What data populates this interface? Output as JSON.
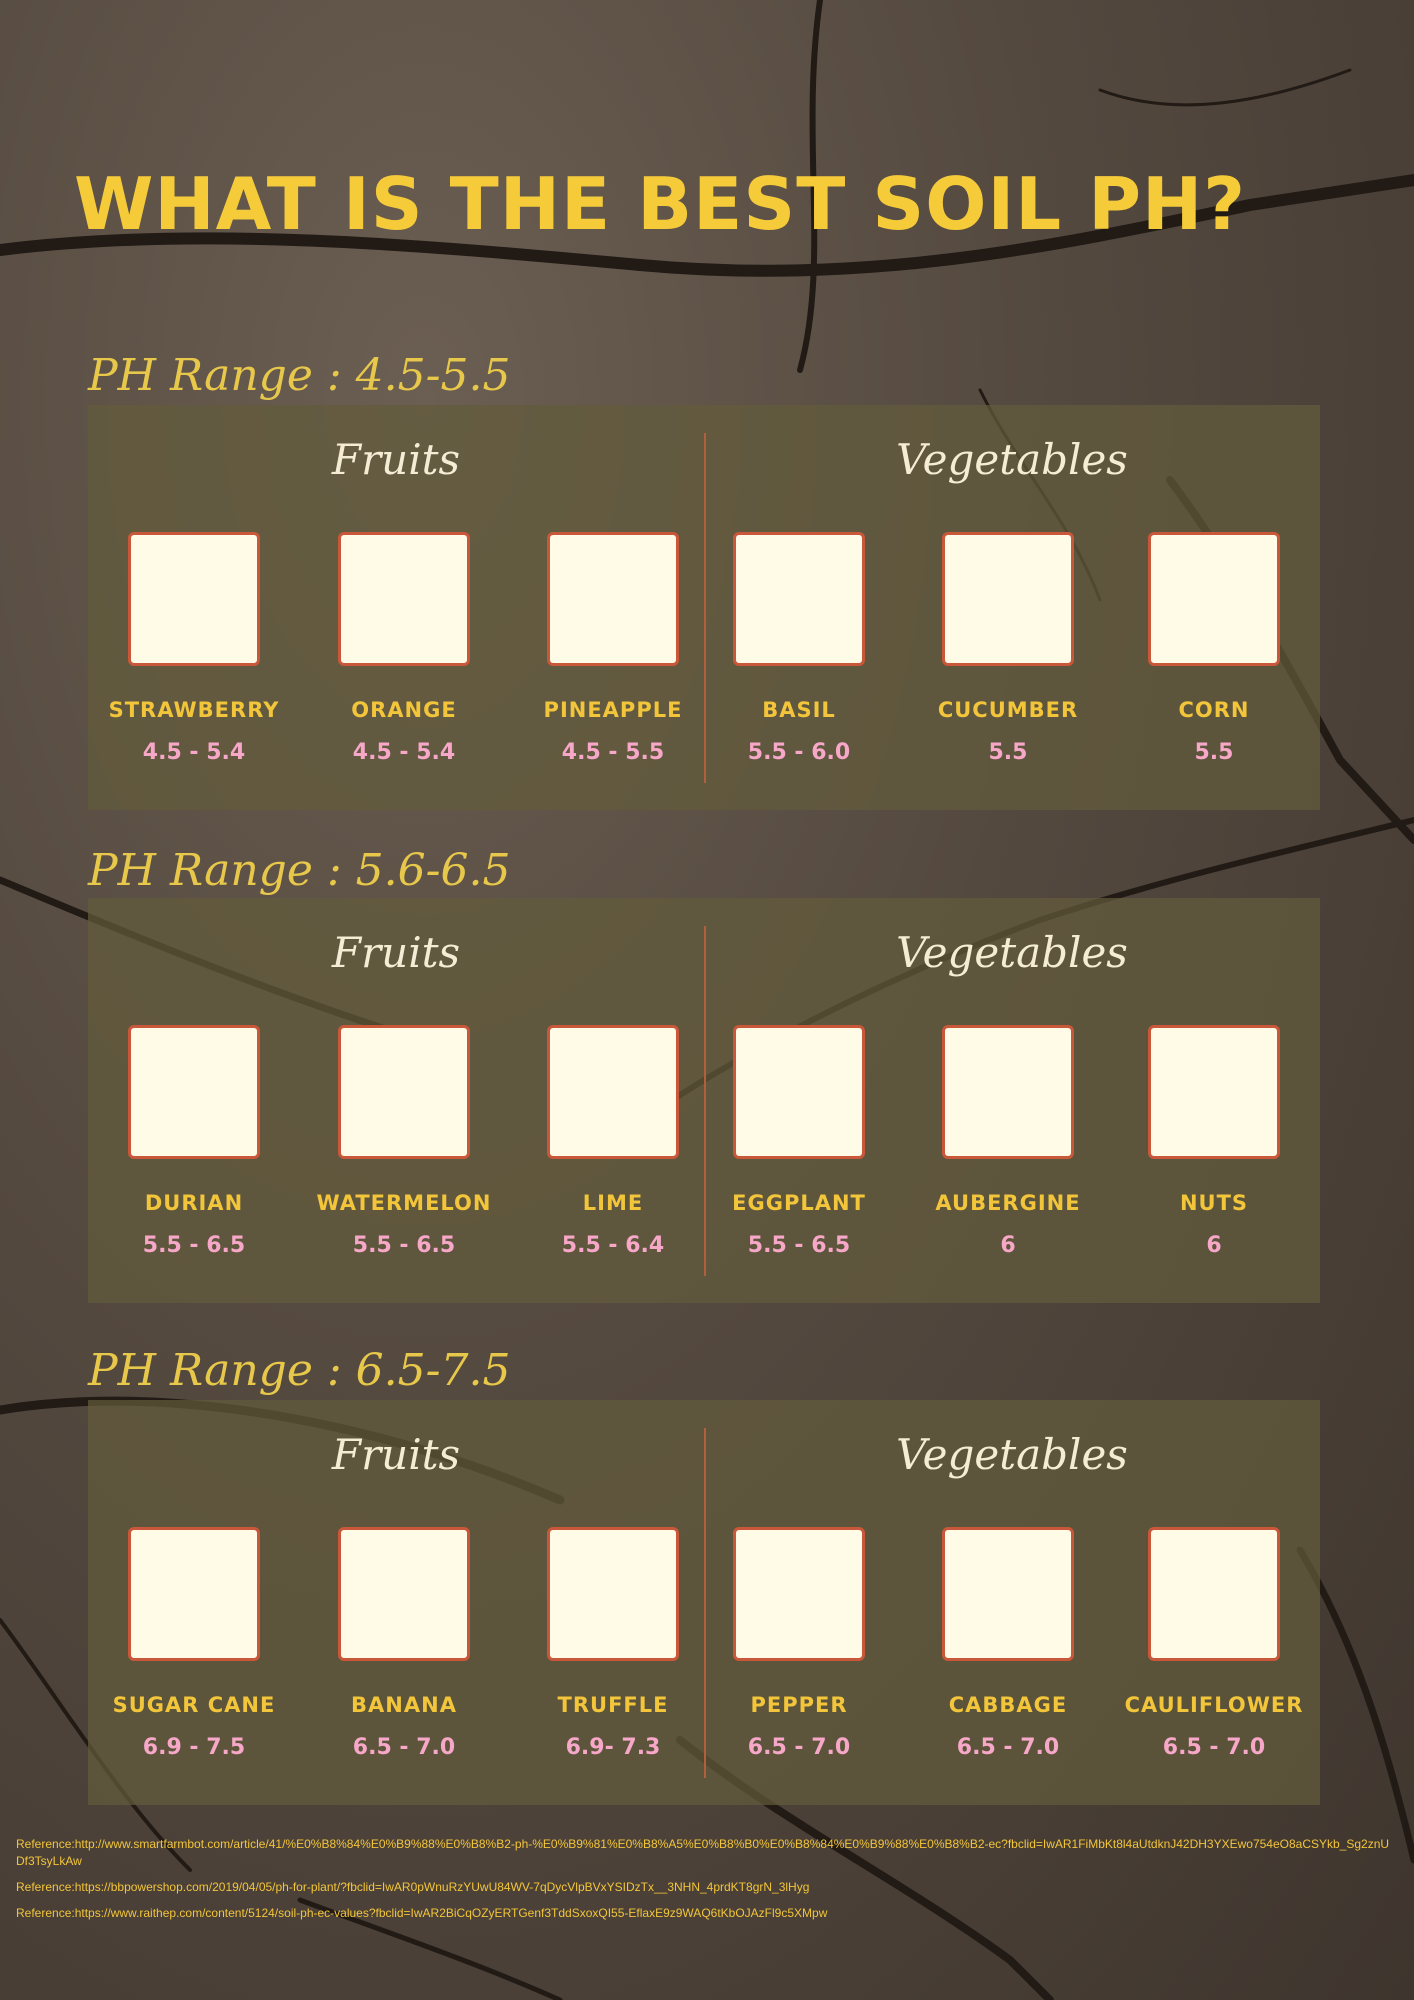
{
  "title": "WHAT IS THE BEST SOIL PH?",
  "sections": [
    {
      "range_label": "PH Range : 4.5-5.5",
      "fruits_title": "Fruits",
      "vegetables_title": "Vegetables",
      "items": [
        {
          "name": "STRAWBERRY",
          "value": "4.5 - 5.4"
        },
        {
          "name": "ORANGE",
          "value": "4.5 - 5.4"
        },
        {
          "name": "PINEAPPLE",
          "value": "4.5 - 5.5"
        },
        {
          "name": "BASIL",
          "value": "5.5 - 6.0"
        },
        {
          "name": "CUCUMBER",
          "value": "5.5"
        },
        {
          "name": "CORN",
          "value": "5.5"
        }
      ]
    },
    {
      "range_label": "PH Range : 5.6-6.5",
      "fruits_title": "Fruits",
      "vegetables_title": "Vegetables",
      "items": [
        {
          "name": "DURIAN",
          "value": "5.5 - 6.5"
        },
        {
          "name": "WATERMELON",
          "value": "5.5 - 6.5"
        },
        {
          "name": "LIME",
          "value": "5.5 - 6.4"
        },
        {
          "name": "EGGPLANT",
          "value": "5.5 - 6.5"
        },
        {
          "name": "AUBERGINE",
          "value": "6"
        },
        {
          "name": "NUTS",
          "value": "6"
        }
      ]
    },
    {
      "range_label": "PH Range : 6.5-7.5",
      "fruits_title": "Fruits",
      "vegetables_title": "Vegetables",
      "items": [
        {
          "name": "SUGAR CANE",
          "value": "6.9 - 7.5"
        },
        {
          "name": "BANANA",
          "value": "6.5 - 7.0"
        },
        {
          "name": "TRUFFLE",
          "value": "6.9- 7.3"
        },
        {
          "name": "PEPPER",
          "value": "6.5 - 7.0"
        },
        {
          "name": "CABBAGE",
          "value": "6.5 - 7.0"
        },
        {
          "name": "CAULIFLOWER",
          "value": "6.5 - 7.0"
        }
      ]
    }
  ],
  "references": [
    "Reference:http://www.smartfarmbot.com/article/41/%E0%B8%84%E0%B9%88%E0%B8%B2-ph-%E0%B9%81%E0%B8%A5%E0%B8%B0%E0%B8%84%E0%B9%88%E0%B8%B2-ec?fbclid=IwAR1FiMbKt8l4aUtdknJ42DH3YXEwo754eO8aCSYkb_Sg2znUDf3TsyLkAw",
    "Reference:https://bbpowershop.com/2019/04/05/ph-for-plant/?fbclid=IwAR0pWnuRzYUwU84WV-7qDycVlpBVxYSIDzTx__3NHN_4prdKT8grN_3lHyg",
    "Reference:https://www.raithep.com/content/5124/soil-ph-ec-values?fbclid=IwAR2BiCqOZyERTGenf3TddSxoxQI55-EflaxE9z9WAQ6tKbOJAzFl9c5XMpw"
  ],
  "colors": {
    "title": "#f6cb3a",
    "range_label": "#e8c84a",
    "item_name": "#f2c53a",
    "item_value": "#f7a7c8",
    "card_border": "#c9573a",
    "card_fill": "#fffbe6",
    "divider": "#b0603d"
  }
}
